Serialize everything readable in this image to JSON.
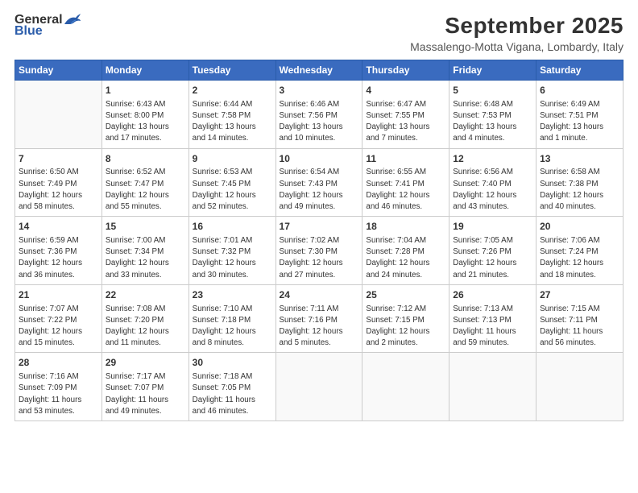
{
  "header": {
    "logo_general": "General",
    "logo_blue": "Blue",
    "title": "September 2025",
    "subtitle": "Massalengo-Motta Vigana, Lombardy, Italy"
  },
  "calendar": {
    "weekdays": [
      "Sunday",
      "Monday",
      "Tuesday",
      "Wednesday",
      "Thursday",
      "Friday",
      "Saturday"
    ],
    "weeks": [
      [
        {
          "day": "",
          "content": ""
        },
        {
          "day": "1",
          "content": "Sunrise: 6:43 AM\nSunset: 8:00 PM\nDaylight: 13 hours\nand 17 minutes."
        },
        {
          "day": "2",
          "content": "Sunrise: 6:44 AM\nSunset: 7:58 PM\nDaylight: 13 hours\nand 14 minutes."
        },
        {
          "day": "3",
          "content": "Sunrise: 6:46 AM\nSunset: 7:56 PM\nDaylight: 13 hours\nand 10 minutes."
        },
        {
          "day": "4",
          "content": "Sunrise: 6:47 AM\nSunset: 7:55 PM\nDaylight: 13 hours\nand 7 minutes."
        },
        {
          "day": "5",
          "content": "Sunrise: 6:48 AM\nSunset: 7:53 PM\nDaylight: 13 hours\nand 4 minutes."
        },
        {
          "day": "6",
          "content": "Sunrise: 6:49 AM\nSunset: 7:51 PM\nDaylight: 13 hours\nand 1 minute."
        }
      ],
      [
        {
          "day": "7",
          "content": "Sunrise: 6:50 AM\nSunset: 7:49 PM\nDaylight: 12 hours\nand 58 minutes."
        },
        {
          "day": "8",
          "content": "Sunrise: 6:52 AM\nSunset: 7:47 PM\nDaylight: 12 hours\nand 55 minutes."
        },
        {
          "day": "9",
          "content": "Sunrise: 6:53 AM\nSunset: 7:45 PM\nDaylight: 12 hours\nand 52 minutes."
        },
        {
          "day": "10",
          "content": "Sunrise: 6:54 AM\nSunset: 7:43 PM\nDaylight: 12 hours\nand 49 minutes."
        },
        {
          "day": "11",
          "content": "Sunrise: 6:55 AM\nSunset: 7:41 PM\nDaylight: 12 hours\nand 46 minutes."
        },
        {
          "day": "12",
          "content": "Sunrise: 6:56 AM\nSunset: 7:40 PM\nDaylight: 12 hours\nand 43 minutes."
        },
        {
          "day": "13",
          "content": "Sunrise: 6:58 AM\nSunset: 7:38 PM\nDaylight: 12 hours\nand 40 minutes."
        }
      ],
      [
        {
          "day": "14",
          "content": "Sunrise: 6:59 AM\nSunset: 7:36 PM\nDaylight: 12 hours\nand 36 minutes."
        },
        {
          "day": "15",
          "content": "Sunrise: 7:00 AM\nSunset: 7:34 PM\nDaylight: 12 hours\nand 33 minutes."
        },
        {
          "day": "16",
          "content": "Sunrise: 7:01 AM\nSunset: 7:32 PM\nDaylight: 12 hours\nand 30 minutes."
        },
        {
          "day": "17",
          "content": "Sunrise: 7:02 AM\nSunset: 7:30 PM\nDaylight: 12 hours\nand 27 minutes."
        },
        {
          "day": "18",
          "content": "Sunrise: 7:04 AM\nSunset: 7:28 PM\nDaylight: 12 hours\nand 24 minutes."
        },
        {
          "day": "19",
          "content": "Sunrise: 7:05 AM\nSunset: 7:26 PM\nDaylight: 12 hours\nand 21 minutes."
        },
        {
          "day": "20",
          "content": "Sunrise: 7:06 AM\nSunset: 7:24 PM\nDaylight: 12 hours\nand 18 minutes."
        }
      ],
      [
        {
          "day": "21",
          "content": "Sunrise: 7:07 AM\nSunset: 7:22 PM\nDaylight: 12 hours\nand 15 minutes."
        },
        {
          "day": "22",
          "content": "Sunrise: 7:08 AM\nSunset: 7:20 PM\nDaylight: 12 hours\nand 11 minutes."
        },
        {
          "day": "23",
          "content": "Sunrise: 7:10 AM\nSunset: 7:18 PM\nDaylight: 12 hours\nand 8 minutes."
        },
        {
          "day": "24",
          "content": "Sunrise: 7:11 AM\nSunset: 7:16 PM\nDaylight: 12 hours\nand 5 minutes."
        },
        {
          "day": "25",
          "content": "Sunrise: 7:12 AM\nSunset: 7:15 PM\nDaylight: 12 hours\nand 2 minutes."
        },
        {
          "day": "26",
          "content": "Sunrise: 7:13 AM\nSunset: 7:13 PM\nDaylight: 11 hours\nand 59 minutes."
        },
        {
          "day": "27",
          "content": "Sunrise: 7:15 AM\nSunset: 7:11 PM\nDaylight: 11 hours\nand 56 minutes."
        }
      ],
      [
        {
          "day": "28",
          "content": "Sunrise: 7:16 AM\nSunset: 7:09 PM\nDaylight: 11 hours\nand 53 minutes."
        },
        {
          "day": "29",
          "content": "Sunrise: 7:17 AM\nSunset: 7:07 PM\nDaylight: 11 hours\nand 49 minutes."
        },
        {
          "day": "30",
          "content": "Sunrise: 7:18 AM\nSunset: 7:05 PM\nDaylight: 11 hours\nand 46 minutes."
        },
        {
          "day": "",
          "content": ""
        },
        {
          "day": "",
          "content": ""
        },
        {
          "day": "",
          "content": ""
        },
        {
          "day": "",
          "content": ""
        }
      ]
    ]
  }
}
